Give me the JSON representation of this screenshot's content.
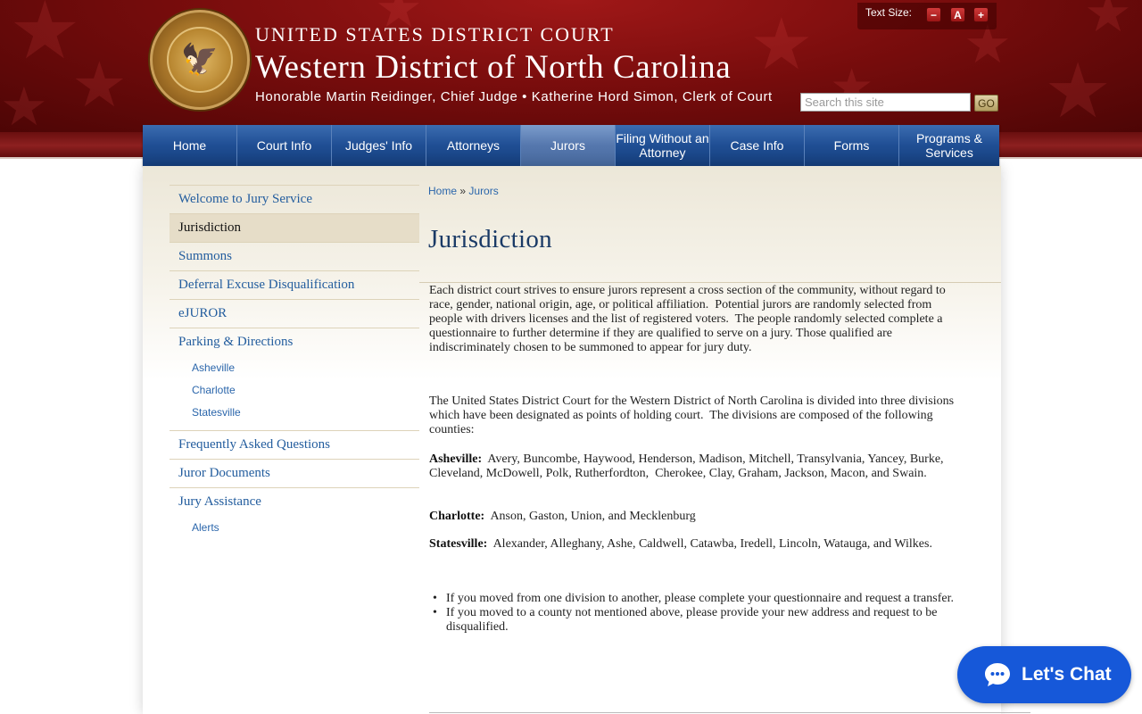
{
  "header": {
    "court_line": "UNITED STATES DISTRICT COURT",
    "district_line": "Western District of North Carolina",
    "judges_line": "Honorable Martin Reidinger, Chief Judge • Katherine Hord Simon, Clerk of Court",
    "seal_icon": "court-seal-eagle",
    "text_size": {
      "label": "Text Size:",
      "decrease": "−",
      "reset": "A",
      "increase": "+"
    },
    "search": {
      "placeholder": "Search this site",
      "value": "",
      "button": "GO"
    }
  },
  "nav": {
    "items": [
      {
        "label": "Home"
      },
      {
        "label": "Court Info"
      },
      {
        "label": "Judges' Info"
      },
      {
        "label": "Attorneys"
      },
      {
        "label": "Jurors",
        "active": true
      },
      {
        "label": "Filing Without an Attorney"
      },
      {
        "label": "Case Info"
      },
      {
        "label": "Forms"
      },
      {
        "label": "Programs & Services"
      }
    ]
  },
  "sidebar": {
    "items": [
      {
        "label": "Welcome to Jury Service"
      },
      {
        "label": "Jurisdiction",
        "active": true
      },
      {
        "label": "Summons"
      },
      {
        "label": "Deferral Excuse Disqualification"
      },
      {
        "label": "eJUROR"
      },
      {
        "label": "Parking & Directions",
        "sub": [
          "Asheville",
          "Charlotte",
          "Statesville"
        ]
      },
      {
        "label": "Frequently Asked Questions"
      },
      {
        "label": "Juror Documents"
      },
      {
        "label": "Jury Assistance",
        "sub": [
          "Alerts"
        ]
      }
    ]
  },
  "breadcrumb": {
    "home": "Home",
    "separator": "»",
    "current": "Jurors"
  },
  "main": {
    "title": "Jurisdiction",
    "paragraph1": "Each district court strives to ensure jurors represent a cross section of the community, without regard to race, gender, national origin, age, or political affiliation.  Potential jurors are randomly selected from people with drivers licenses and the list of registered voters.  The people randomly selected complete a questionnaire to further determine if they are qualified to serve on a jury. Those qualified are indiscriminately chosen to be summoned to appear for jury duty.",
    "paragraph2": "The United States District Court for the Western District of North Carolina is divided into three divisions which have been designated as points of holding court.  The divisions are composed of the following counties:",
    "divisions": [
      {
        "name": "Asheville:",
        "counties": "Avery, Buncombe, Haywood, Henderson, Madison, Mitchell, Transylvania, Yancey, Burke, Cleveland, McDowell, Polk, Rutherfordton,  Cherokee, Clay, Graham, Jackson, Macon, and Swain."
      },
      {
        "name": "Charlotte:",
        "counties": "Anson, Gaston, Union, and Mecklenburg"
      },
      {
        "name": "Statesville:",
        "counties": "Alexander, Alleghany, Ashe, Caldwell, Catawba, Iredell, Lincoln, Watauga, and Wilkes."
      }
    ],
    "bullets": [
      "If you moved from one division to another, please complete your questionnaire and request a transfer.",
      "If you moved to a county not mentioned above, please provide your new address and request to be disqualified."
    ]
  },
  "chat": {
    "label": "Let's Chat",
    "icon": "chat-bubble-icon",
    "color": "#1658d9"
  },
  "colors": {
    "header_red": "#7a0d0d",
    "nav_blue": "#1f4e94",
    "link_blue": "#235d9e",
    "title_navy": "#1a3a66"
  }
}
